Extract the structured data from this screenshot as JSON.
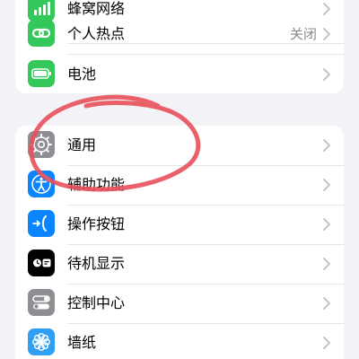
{
  "settings": {
    "top_group": {
      "network_row": {
        "label": "蜂窝网络",
        "icon": "cellular-antenna-icon",
        "color": "#34c759"
      },
      "hotspot_row": {
        "label": "个人热点",
        "value": "关闭",
        "icon": "hotspot-chain-icon",
        "color": "#34c759"
      },
      "battery_row": {
        "label": "电池",
        "icon": "battery-icon",
        "color": "#34c759"
      }
    },
    "main_group": {
      "general_row": {
        "label": "通用",
        "icon": "gear-icon",
        "color": "#8e8e93"
      },
      "accessibility_row": {
        "label": "辅助功能",
        "icon": "accessibility-person-icon",
        "color": "#0a84ff"
      },
      "action_button_row": {
        "label": "操作按钮",
        "icon": "action-button-icon",
        "color": "#0a84ff"
      },
      "standby_row": {
        "label": "待机显示",
        "icon": "standby-icon",
        "color": "#000000"
      },
      "control_center_row": {
        "label": "控制中心",
        "icon": "toggles-icon",
        "color": "#8e8e93"
      },
      "wallpaper_row": {
        "label": "墙纸",
        "icon": "flower-icon",
        "color": "#2f9ef5"
      }
    }
  },
  "annotation": {
    "type": "hand-drawn circle",
    "color": "#e8505b"
  }
}
